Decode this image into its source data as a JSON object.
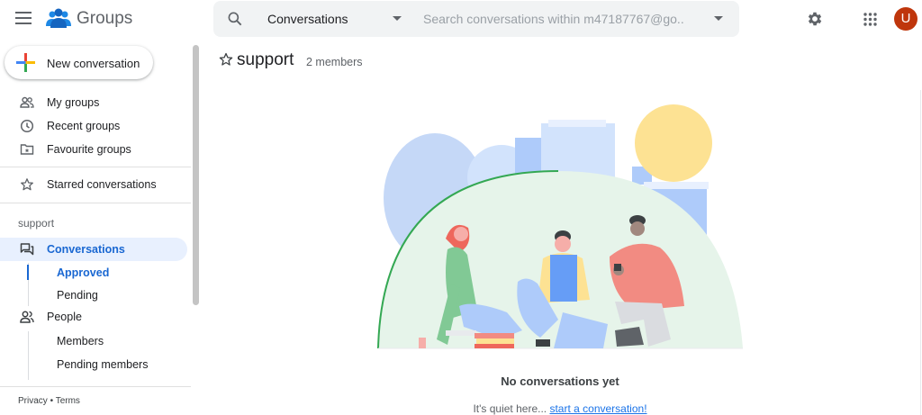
{
  "app": {
    "name": "Groups"
  },
  "search": {
    "scope": "Conversations",
    "placeholder": "Search conversations within m47187767@go..."
  },
  "user": {
    "avatar_letter": "U",
    "avatar_color": "#bf360c"
  },
  "sidebar": {
    "new_conversation": "New conversation",
    "items": [
      {
        "label": "My groups",
        "icon": "people-outline-icon"
      },
      {
        "label": "Recent groups",
        "icon": "clock-icon"
      },
      {
        "label": "Favourite groups",
        "icon": "folder-star-icon"
      },
      {
        "label": "Starred conversations",
        "icon": "star-outline-icon"
      }
    ],
    "group_section": "support",
    "group_nav": {
      "conversations": "Conversations",
      "approved": "Approved",
      "pending": "Pending",
      "people": "People",
      "members": "Members",
      "pending_members": "Pending members"
    },
    "footer": {
      "privacy": "Privacy",
      "separator": " • ",
      "terms": "Terms"
    }
  },
  "main": {
    "group_title": "support",
    "member_count": "2 members",
    "empty_title": "No conversations yet",
    "empty_message": "It's quiet here... ",
    "empty_link": "start a conversation!"
  },
  "colors": {
    "accent": "#1967d2",
    "active_bg": "#e8f0fe",
    "link": "#1a73e8"
  }
}
